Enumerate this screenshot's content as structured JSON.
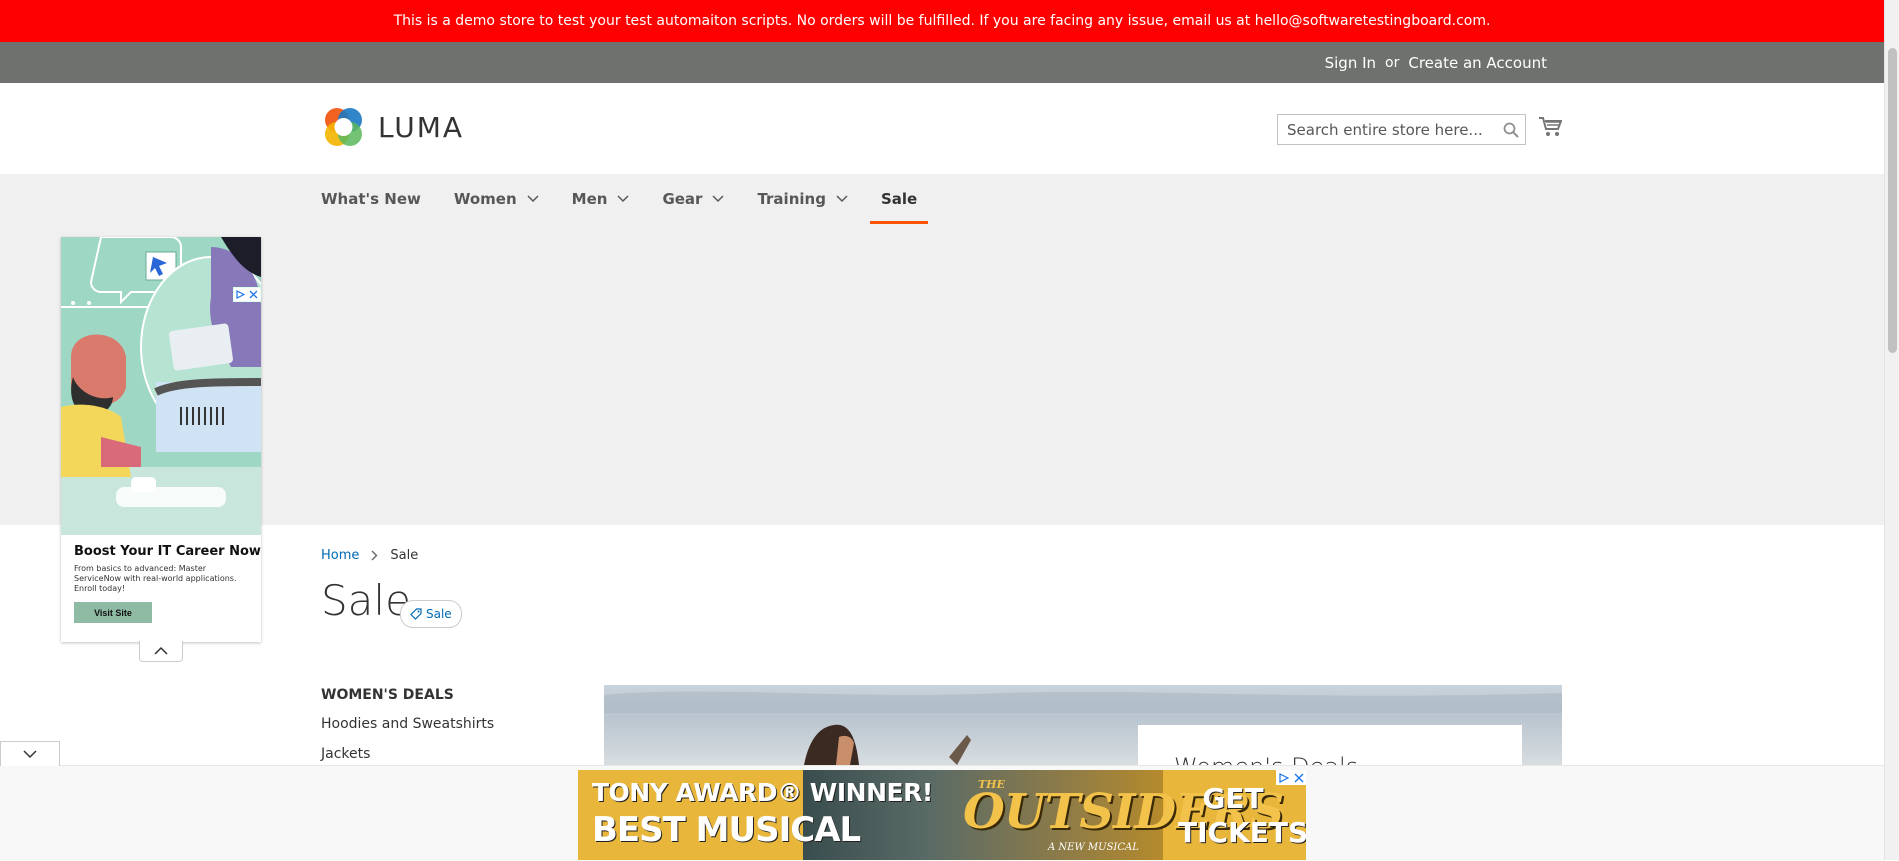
{
  "demo_banner": {
    "text": "This is a demo store to test your test automaiton scripts. No orders will be fulfilled. If you are facing any issue, email us at hello@softwaretestingboard.com."
  },
  "top_links": {
    "sign_in": "Sign In",
    "separator": "or",
    "create_account": "Create an Account"
  },
  "header": {
    "logo_text": "LUMA",
    "search_placeholder": "Search entire store here...",
    "icons": {
      "search": "search-icon",
      "cart": "cart-icon"
    }
  },
  "nav": {
    "items": [
      {
        "label": "What's New",
        "has_dropdown": false
      },
      {
        "label": "Women",
        "has_dropdown": true
      },
      {
        "label": "Men",
        "has_dropdown": true
      },
      {
        "label": "Gear",
        "has_dropdown": true
      },
      {
        "label": "Training",
        "has_dropdown": true
      },
      {
        "label": "Sale",
        "has_dropdown": false,
        "active": true
      }
    ]
  },
  "side_ad": {
    "title": "Boost Your IT Career Now",
    "description": "From basics to advanced: Master ServiceNow with real-world applications. Enroll today!",
    "button": "Visit Site"
  },
  "breadcrumb": {
    "home": "Home",
    "current": "Sale"
  },
  "page": {
    "title": "Sale",
    "badge": "Sale"
  },
  "sidebar": {
    "heading": "WOMEN'S DEALS",
    "items": [
      "Hoodies and Sweatshirts",
      "Jackets"
    ]
  },
  "hero": {
    "card_title": "Women's Deals"
  },
  "bottom_ad": {
    "line1": "TONY AWARD® WINNER!",
    "line2": "BEST MUSICAL",
    "the": "THE",
    "title": "OUTSIDERS",
    "subtitle": "A NEW MUSICAL",
    "cta_line1": "GET",
    "cta_line2": "TICKETS"
  },
  "colors": {
    "banner": "#ff0000",
    "top_bar": "#6e716e",
    "accent": "#ff5501",
    "link": "#006bb4"
  }
}
